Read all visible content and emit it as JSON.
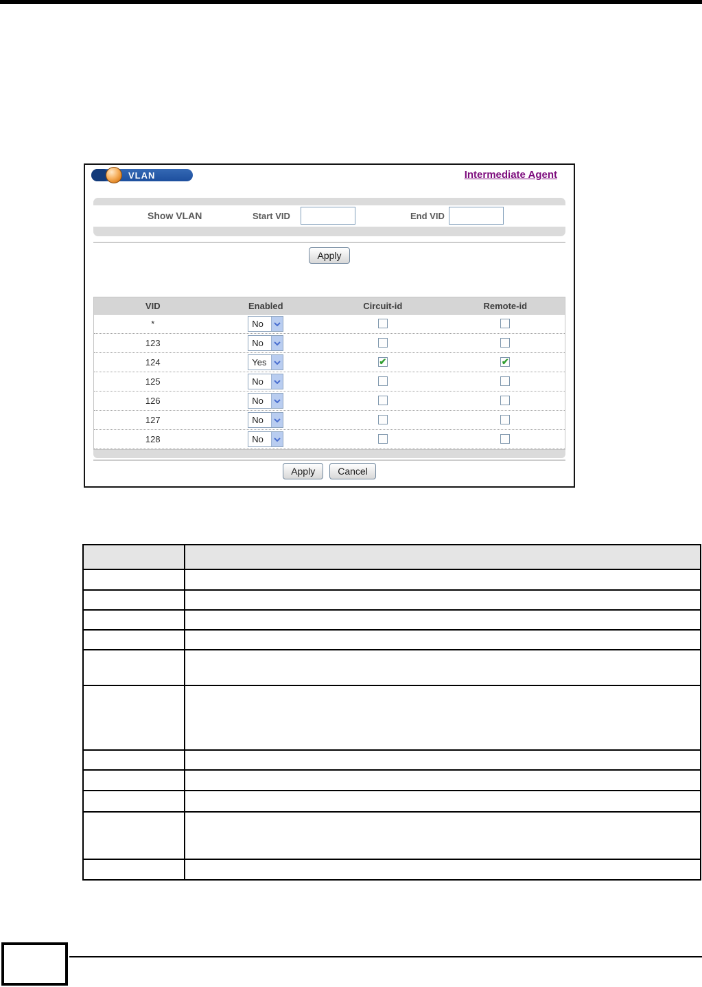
{
  "screenshot": {
    "title": "VLAN",
    "link_label": "Intermediate Agent",
    "show_vlan": {
      "label": "Show VLAN",
      "start_vid_label": "Start VID",
      "start_vid_value": "",
      "end_vid_label": "End VID",
      "end_vid_value": ""
    },
    "apply_top_label": "Apply",
    "table": {
      "headers": [
        "VID",
        "Enabled",
        "Circuit-id",
        "Remote-id"
      ],
      "rows": [
        {
          "vid": "*",
          "enabled": "No",
          "circuit_id": false,
          "remote_id": false
        },
        {
          "vid": "123",
          "enabled": "No",
          "circuit_id": false,
          "remote_id": false
        },
        {
          "vid": "124",
          "enabled": "Yes",
          "circuit_id": true,
          "remote_id": true
        },
        {
          "vid": "125",
          "enabled": "No",
          "circuit_id": false,
          "remote_id": false
        },
        {
          "vid": "126",
          "enabled": "No",
          "circuit_id": false,
          "remote_id": false
        },
        {
          "vid": "127",
          "enabled": "No",
          "circuit_id": false,
          "remote_id": false
        },
        {
          "vid": "128",
          "enabled": "No",
          "circuit_id": false,
          "remote_id": false
        }
      ]
    },
    "apply_bottom_label": "Apply",
    "cancel_label": "Cancel"
  },
  "colors": {
    "pill_blue": "#1d4f9e",
    "orb_orange": "#f6b05e",
    "link_purple": "#7d0c7d",
    "check_green": "#2f9e2f",
    "header_gray": "#d5d5d5"
  },
  "doc_table": {
    "header": [
      "",
      ""
    ],
    "rows": [
      [
        "",
        ""
      ],
      [
        "",
        ""
      ],
      [
        "",
        ""
      ],
      [
        "",
        ""
      ],
      [
        "",
        ""
      ],
      [
        "",
        ""
      ],
      [
        "",
        ""
      ],
      [
        "",
        ""
      ],
      [
        "",
        ""
      ],
      [
        "",
        ""
      ],
      [
        "",
        ""
      ]
    ]
  }
}
